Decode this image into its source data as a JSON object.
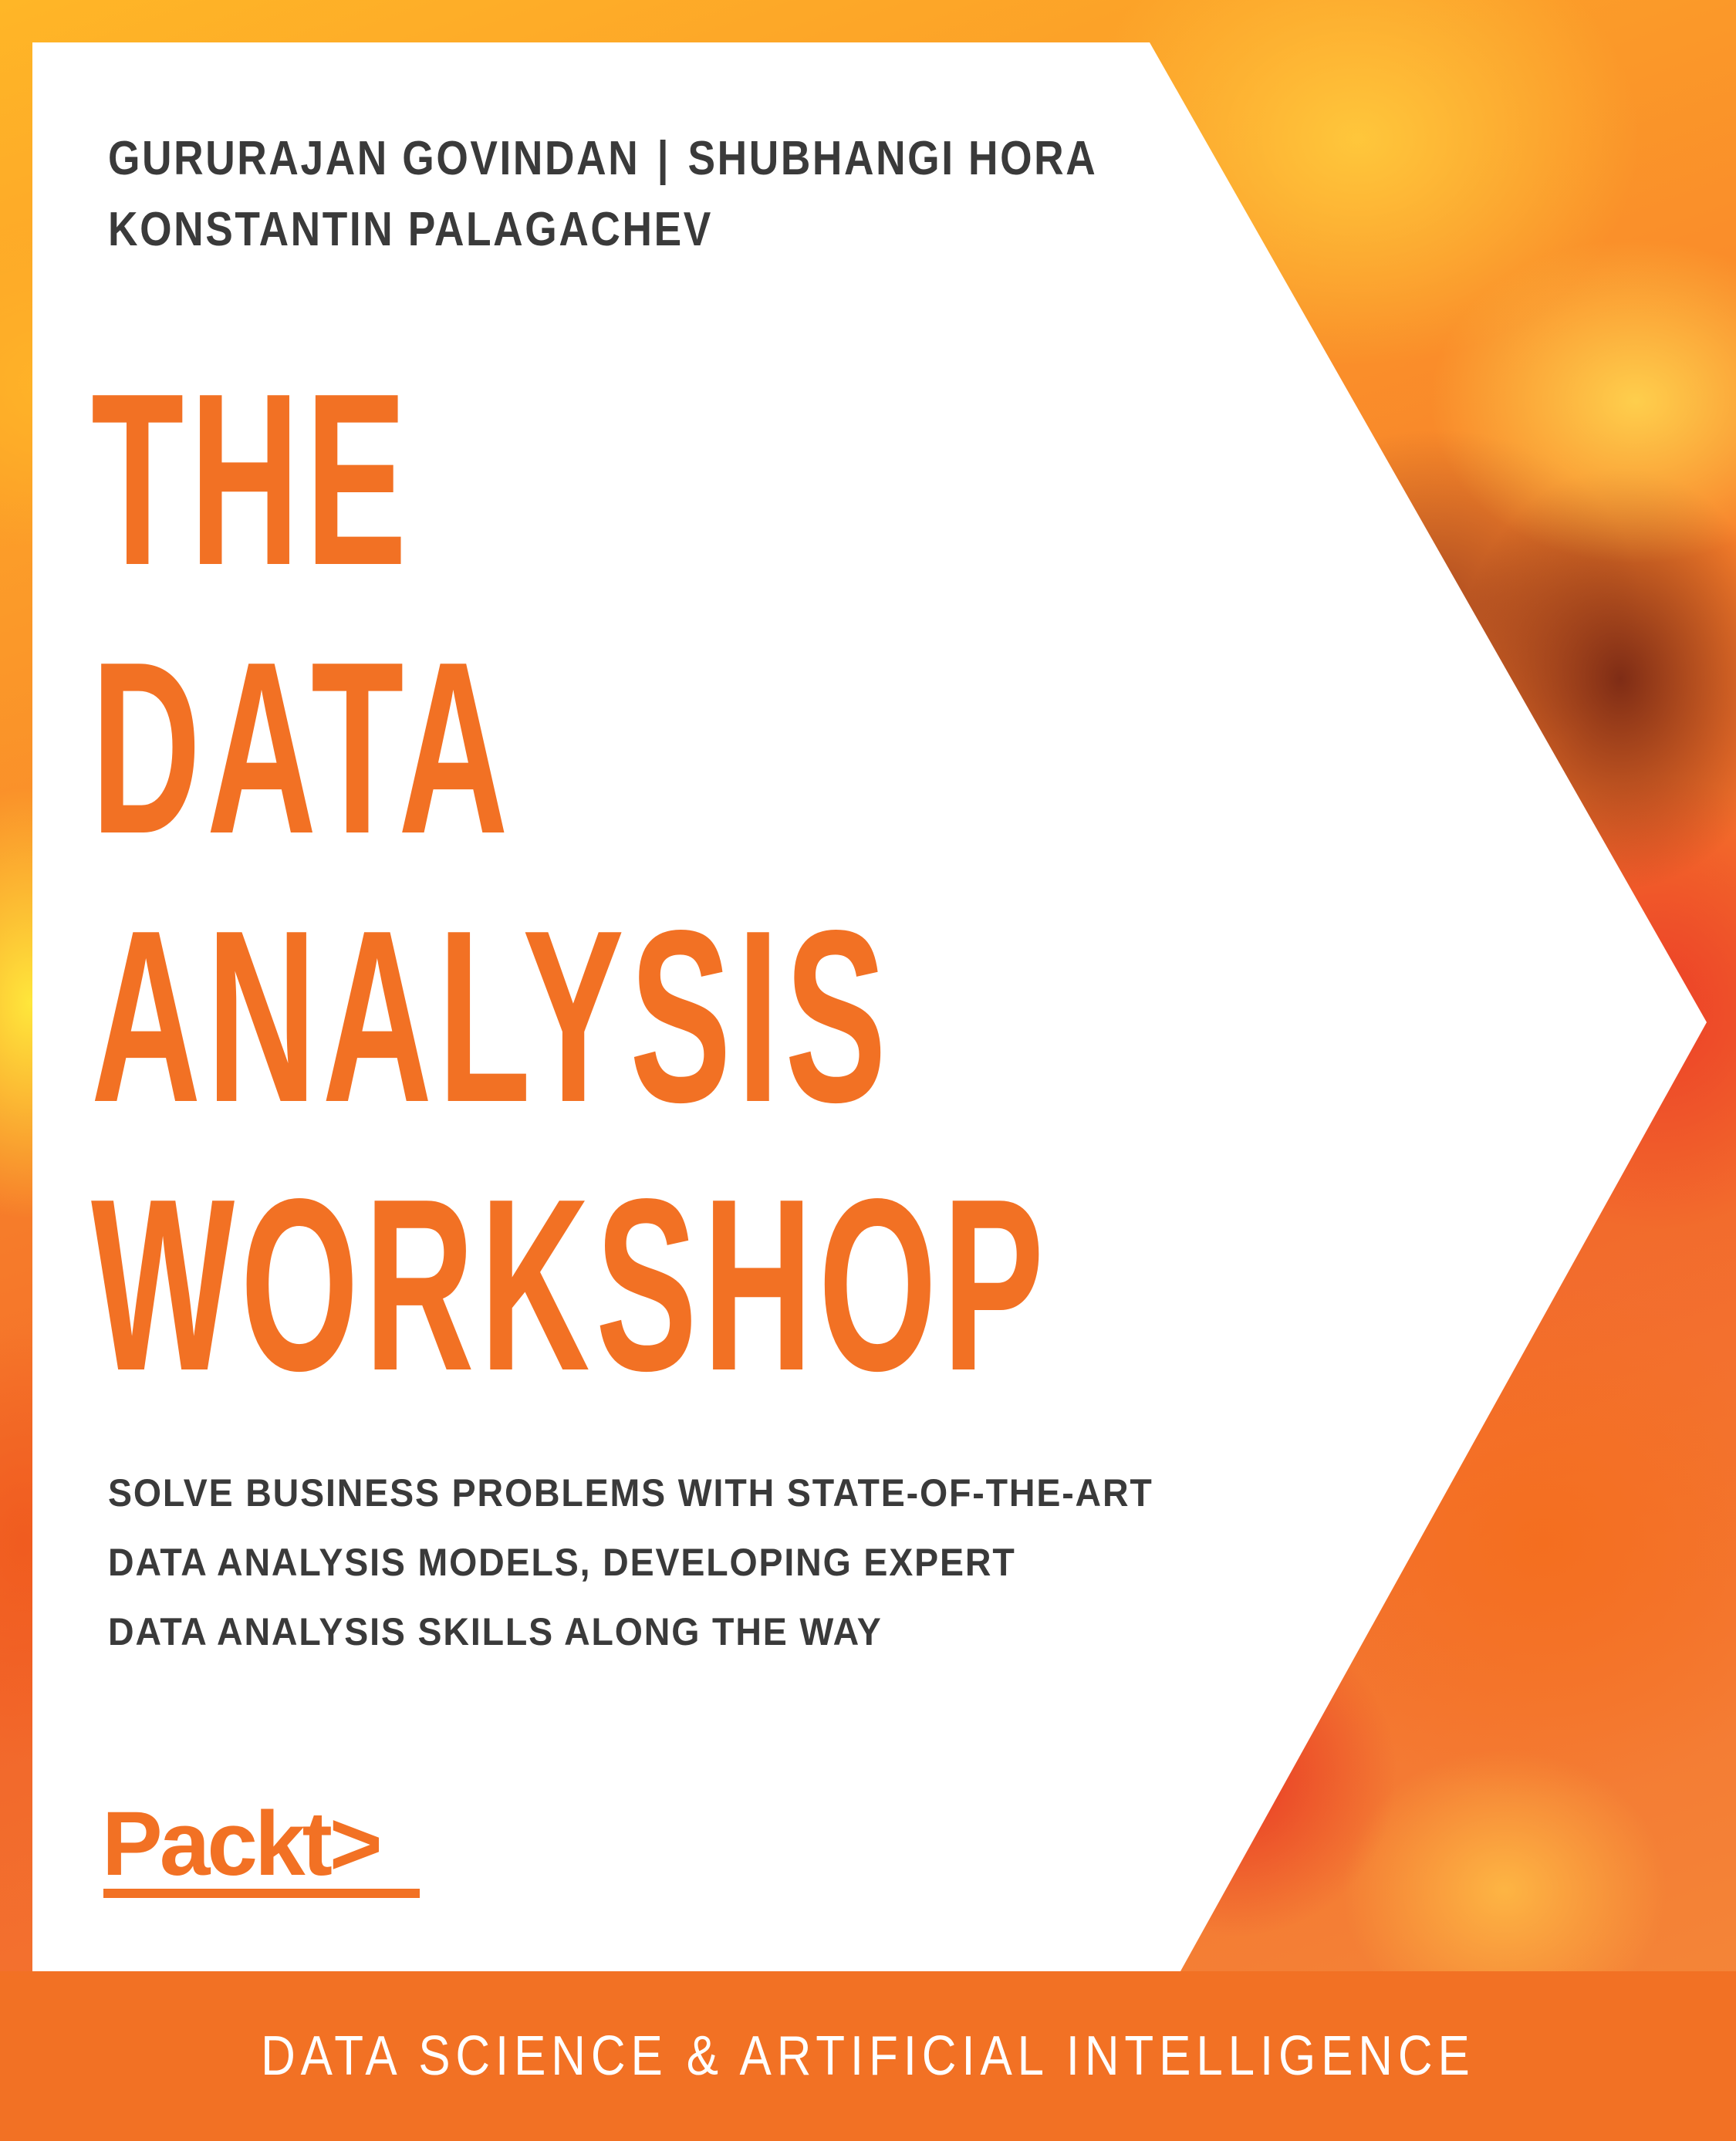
{
  "authors": {
    "line1_author1": "GURURAJAN GOVINDAN",
    "separator": "|",
    "line1_author2": "SHUBHANGI HORA",
    "line2_author3": "KONSTANTIN PALAGACHEV"
  },
  "title": {
    "line1": "THE",
    "line2": "DATA",
    "line3": "ANALYSIS",
    "line4": "WORKSHOP"
  },
  "subtitle": {
    "line1": "SOLVE BUSINESS PROBLEMS WITH STATE-OF-THE-ART",
    "line2": "DATA ANALYSIS MODELS, DEVELOPING EXPERT",
    "line3": "DATA ANALYSIS SKILLS ALONG THE WAY"
  },
  "publisher": {
    "logo_text": "Packt>"
  },
  "category": {
    "label": "DATA SCIENCE & ARTIFICIAL INTELLIGENCE"
  },
  "colors": {
    "accent_orange": "#f27124",
    "text_dark": "#3a3a3a",
    "panel_white": "#ffffff",
    "footer_text": "#ffffff"
  }
}
